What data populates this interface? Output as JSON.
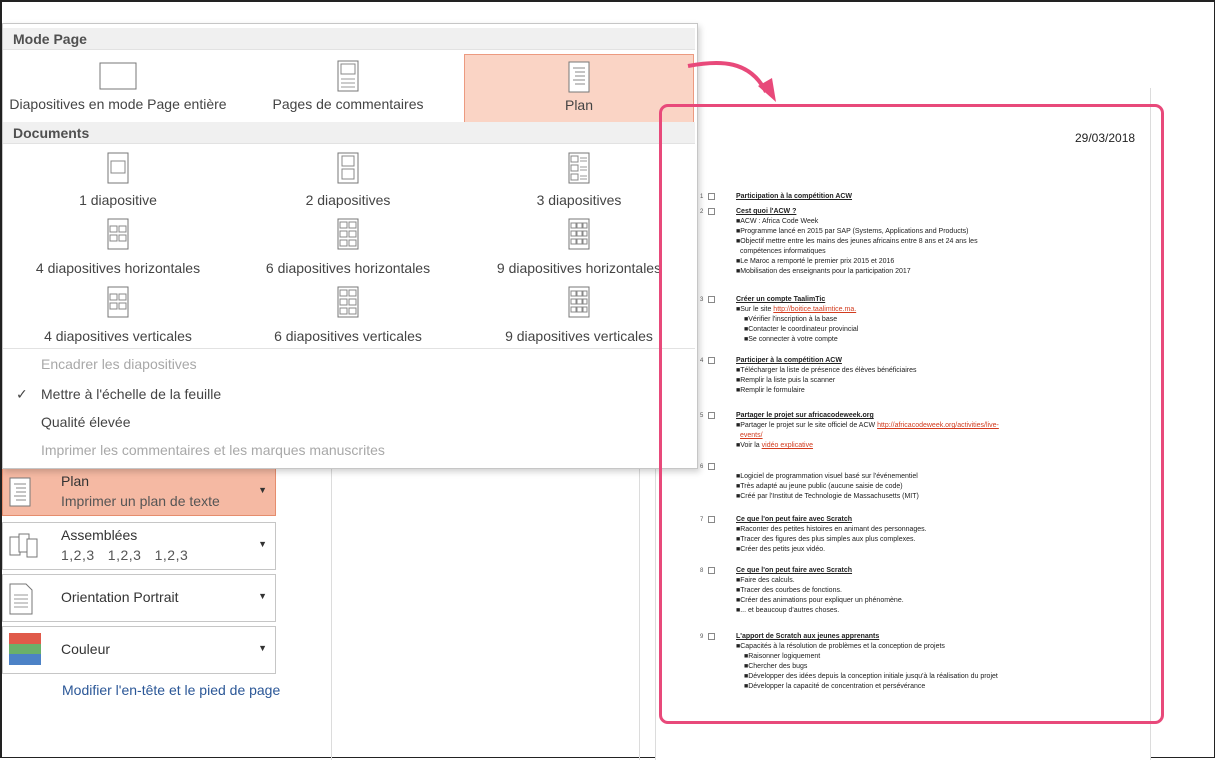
{
  "dropdown": {
    "section_mode_page": "Mode Page",
    "section_documents": "Documents",
    "mode_tiles": [
      {
        "label": "Diapositives en mode Page entière",
        "icon": "full-page-slide-icon"
      },
      {
        "label": "Pages de commentaires",
        "icon": "notes-pages-icon"
      },
      {
        "label": "Plan",
        "icon": "outline-icon",
        "selected": true
      }
    ],
    "document_tiles": [
      {
        "label": "1 diapositive",
        "icon": "one-slide-icon"
      },
      {
        "label": "2 diapositives",
        "icon": "two-slides-icon"
      },
      {
        "label": "3 diapositives",
        "icon": "three-slides-icon"
      },
      {
        "label": "4 diapositives horizontales",
        "icon": "four-slides-horizontal-icon"
      },
      {
        "label": "6 diapositives horizontales",
        "icon": "six-slides-horizontal-icon"
      },
      {
        "label": "9 diapositives horizontales",
        "icon": "nine-slides-horizontal-icon"
      },
      {
        "label": "4 diapositives verticales",
        "icon": "four-slides-vertical-icon"
      },
      {
        "label": "6 diapositives verticales",
        "icon": "six-slides-vertical-icon"
      },
      {
        "label": "9 diapositives verticales",
        "icon": "nine-slides-vertical-icon"
      }
    ],
    "options": {
      "frame_slides": "Encadrer les diapositives",
      "scale_to_paper": "Mettre à l'échelle de la feuille",
      "high_quality": "Qualité élevée",
      "print_comments": "Imprimer les commentaires et les marques manuscrites"
    },
    "check_mark": "✓"
  },
  "settings": {
    "layout": {
      "title": "Plan",
      "subtitle": "Imprimer un plan de texte"
    },
    "collated": {
      "title": "Assemblées",
      "subtitle": "1,2,3   1,2,3   1,2,3"
    },
    "orientation": {
      "title": "Orientation Portrait"
    },
    "color": {
      "title": "Couleur"
    },
    "header_footer_link": "Modifier l'en-tête et le pied de page"
  },
  "preview": {
    "date": "29/03/2018",
    "outline": [
      {
        "num": "1",
        "title": "Participation à la compétition ACW",
        "bullets": []
      },
      {
        "num": "2",
        "title": "Cest quoi l'ACW ?",
        "bullets": [
          {
            "level": 1,
            "text": "ACW : Africa Code Week"
          },
          {
            "level": 1,
            "text": "Programme lancé en 2015 par SAP (Systems, Applications and Products)"
          },
          {
            "level": 1,
            "text": "Objectif mettre entre les mains des jeunes africains entre 8 ans et 24 ans les"
          },
          {
            "level": 0,
            "text": "compétences informatiques"
          },
          {
            "level": 1,
            "text": "Le Maroc a remporté le premier prix 2015 et 2016"
          },
          {
            "level": 1,
            "text": "Mobilisation des enseignants pour la participation 2017"
          }
        ]
      },
      {
        "num": "3",
        "title": "Créer un compte TaalimTic",
        "bullets": [
          {
            "level": 1,
            "text": "Sur le site ",
            "link": "http://boitice.taalimtice.ma."
          },
          {
            "level": 2,
            "text": "Vérifier l'inscription à la base"
          },
          {
            "level": 2,
            "text": "Contacter le coordinateur provincial"
          },
          {
            "level": 2,
            "text": "Se connecter à votre compte"
          }
        ]
      },
      {
        "num": "4",
        "title": "Participer à la compétition ACW",
        "bullets": [
          {
            "level": 1,
            "text": "Télécharger la liste de présence des élèves bénéficiaires"
          },
          {
            "level": 1,
            "text": "Remplir la liste puis la scanner"
          },
          {
            "level": 1,
            "text": "Remplir le formulaire"
          }
        ]
      },
      {
        "num": "5",
        "title": "Partager le projet sur africacodeweek.org",
        "bullets": [
          {
            "level": 1,
            "text": "Partager le projet sur le site officiel de ACW ",
            "link": "http://africacodeweek.org/activities/live-"
          },
          {
            "level": 0,
            "text": "",
            "link": "events/"
          },
          {
            "level": 1,
            "text": "Voir la ",
            "link": "vidéo explicative"
          }
        ]
      },
      {
        "num": "6",
        "title": "",
        "bullets": [
          {
            "level": 1,
            "text": "Logiciel de programmation visuel basé sur l'événementiel"
          },
          {
            "level": 1,
            "text": "Très adapté au jeune public (aucune saisie de code)"
          },
          {
            "level": 1,
            "text": "Créé par l'Institut de Technologie de Massachusetts (MIT)"
          }
        ]
      },
      {
        "num": "7",
        "title": "Ce que l'on peut faire avec Scratch",
        "bullets": [
          {
            "level": 1,
            "text": "Raconter des petites histoires en animant des personnages."
          },
          {
            "level": 1,
            "text": "Tracer des figures des plus simples aux plus complexes."
          },
          {
            "level": 1,
            "text": "Créer des petits jeux vidéo."
          }
        ]
      },
      {
        "num": "8",
        "title": "Ce que l'on peut faire avec Scratch",
        "bullets": [
          {
            "level": 1,
            "text": "Faire des calculs."
          },
          {
            "level": 1,
            "text": "Tracer des courbes de fonctions."
          },
          {
            "level": 1,
            "text": "Créer des animations pour expliquer un phénomène."
          },
          {
            "level": 1,
            "text": "... et beaucoup d'autres choses."
          }
        ]
      },
      {
        "num": "9",
        "title": "L'apport de Scratch aux jeunes apprenants",
        "bullets": [
          {
            "level": 1,
            "text": "Capacités à la résolution de problèmes et la conception de projets"
          },
          {
            "level": 2,
            "text": "Raisonner logiquement"
          },
          {
            "level": 2,
            "text": "Chercher des bugs"
          },
          {
            "level": 2,
            "text": "Développer des idées depuis la conception initiale jusqu'à la réalisation du projet"
          },
          {
            "level": 2,
            "text": "Développer la capacité de concentration et persévérance"
          }
        ]
      }
    ]
  },
  "colors": {
    "accent_selected": "#fad4c5",
    "highlight_frame": "#e8497a",
    "link": "#2b5797"
  }
}
